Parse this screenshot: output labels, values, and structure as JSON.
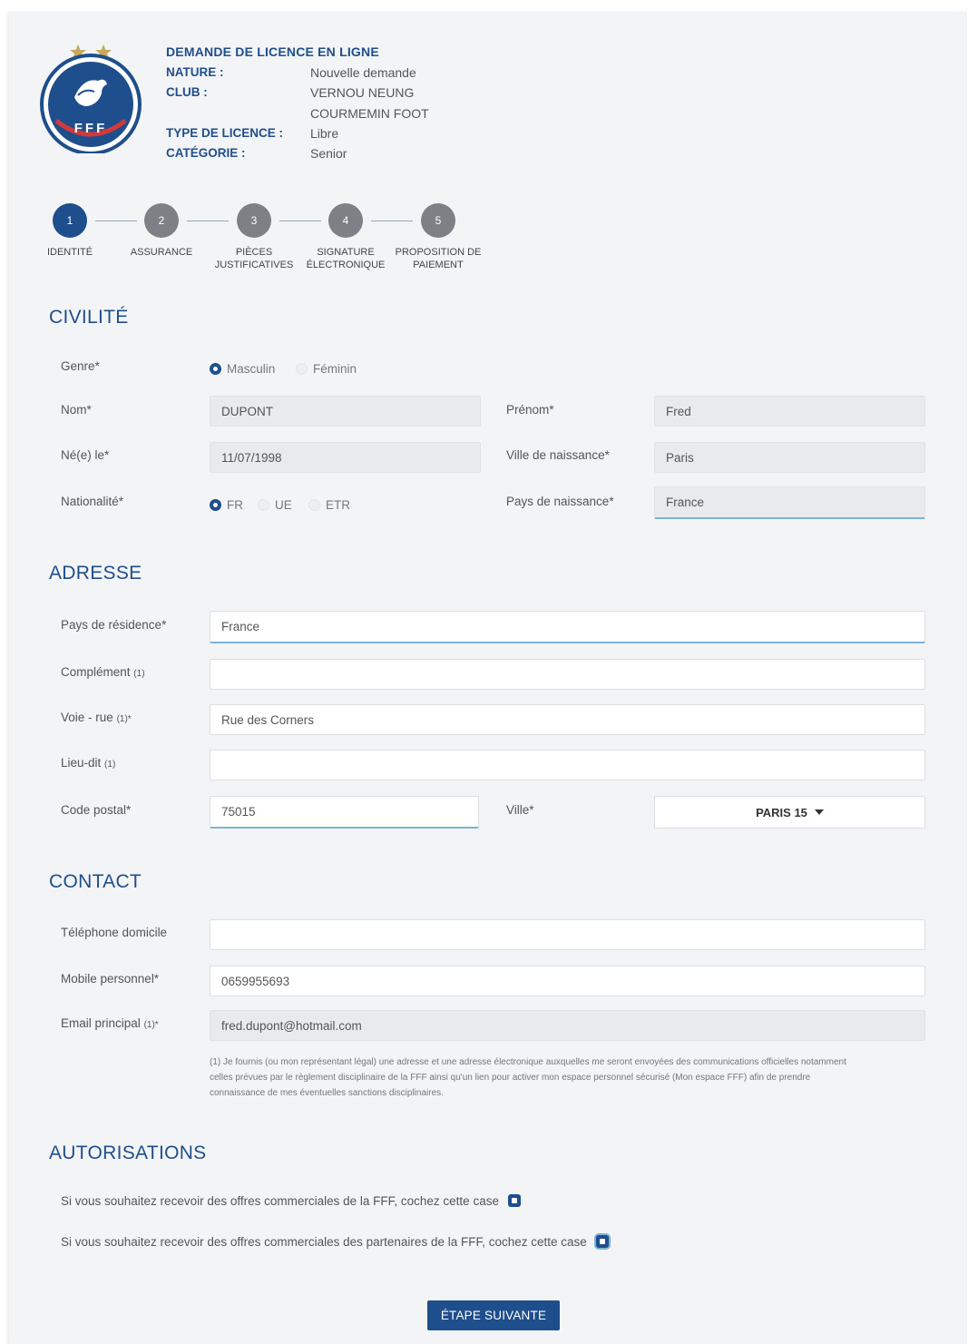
{
  "header": {
    "title": "DEMANDE DE LICENCE EN LIGNE",
    "nature_label": "NATURE :",
    "nature_value": "Nouvelle demande",
    "club_label": "CLUB :",
    "club_value_line1": "VERNOU NEUNG",
    "club_value_line2": "COURMEMIN FOOT",
    "type_label": "TYPE DE LICENCE :",
    "type_value": "Libre",
    "categorie_label": "CATÉGORIE :",
    "categorie_value": "Senior",
    "logo_text": "FFF"
  },
  "stepper": {
    "steps": [
      {
        "number": "1",
        "label_line1": "IDENTITÉ",
        "label_line2": "",
        "active": true
      },
      {
        "number": "2",
        "label_line1": "ASSURANCE",
        "label_line2": "",
        "active": false
      },
      {
        "number": "3",
        "label_line1": "PIÈCES",
        "label_line2": "JUSTIFICATIVES",
        "active": false
      },
      {
        "number": "4",
        "label_line1": "SIGNATURE",
        "label_line2": "ÉLECTRONIQUE",
        "active": false
      },
      {
        "number": "5",
        "label_line1": "PROPOSITION DE",
        "label_line2": "PAIEMENT",
        "active": false
      }
    ]
  },
  "civilite": {
    "title": "CIVILITÉ",
    "genre_label": "Genre*",
    "genre_options": [
      "Masculin",
      "Féminin"
    ],
    "genre_selected": "Masculin",
    "nom_label": "Nom*",
    "nom_value": "DUPONT",
    "prenom_label": "Prénom*",
    "prenom_value": "Fred",
    "naissance_label": "Né(e) le*",
    "naissance_value": "11/07/1998",
    "ville_naissance_label": "Ville de naissance*",
    "ville_naissance_value": "Paris",
    "nationalite_label": "Nationalité*",
    "nationalite_options": [
      "FR",
      "UE",
      "ETR"
    ],
    "nationalite_selected": "FR",
    "pays_naissance_label": "Pays de naissance*",
    "pays_naissance_value": "France"
  },
  "adresse": {
    "title": "ADRESSE",
    "pays_label": "Pays de résidence*",
    "pays_value": "France",
    "complement_label": "Complément",
    "complement_note": "(1)",
    "complement_value": "",
    "voie_label": "Voie - rue",
    "voie_note": "(1)*",
    "voie_value": "Rue des Corners",
    "lieudit_label": "Lieu-dit",
    "lieudit_note": "(1)",
    "lieudit_value": "",
    "cp_label": "Code postal*",
    "cp_value": "75015",
    "ville_label": "Ville*",
    "ville_value": "PARIS 15"
  },
  "contact": {
    "title": "CONTACT",
    "tel_label": "Téléphone domicile",
    "tel_value": "",
    "mobile_label": "Mobile personnel*",
    "mobile_value": "0659955693",
    "email_label": "Email principal",
    "email_note": "(1)*",
    "email_value": "fred.dupont@hotmail.com",
    "footnote_line1": "(1) Je fournis (ou mon représentant légal) une adresse et une adresse électronique auxquelles me seront envoyées des communications officielles notamment",
    "footnote_line2": "celles prévues par le règlement disciplinaire de la FFF ainsi qu'un lien pour activer mon espace personnel sécurisé (Mon espace FFF) afin de prendre",
    "footnote_line3": "connaissance de mes éventuelles sanctions disciplinaires."
  },
  "autorisations": {
    "title": "AUTORISATIONS",
    "offre_fff": "Si vous souhaitez recevoir des offres commerciales de la FFF, cochez cette case",
    "offre_partenaires": "Si vous souhaitez recevoir des offres commerciales des partenaires de la FFF, cochez cette case"
  },
  "actions": {
    "next_label": "ÉTAPE SUIVANTE"
  },
  "colors": {
    "accent": "#1f4e8c",
    "step_inactive": "#7d8084",
    "page_bg": "#f3f4f6",
    "focus_line": "#7fb2d8"
  }
}
